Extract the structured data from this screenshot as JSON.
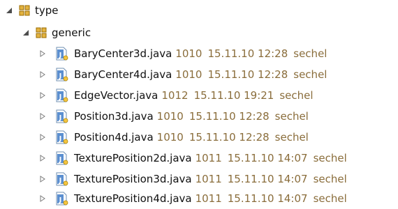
{
  "tree": {
    "root": {
      "label": "type"
    },
    "package": {
      "label": "generic"
    },
    "files": [
      {
        "name": "BaryCenter3d.java",
        "rev": "1010",
        "date": "15.11.10 12:28",
        "author": "sechel"
      },
      {
        "name": "BaryCenter4d.java",
        "rev": "1010",
        "date": "15.11.10 12:28",
        "author": "sechel"
      },
      {
        "name": "EdgeVector.java",
        "rev": "1012",
        "date": "15.11.10 19:21",
        "author": "sechel"
      },
      {
        "name": "Position3d.java",
        "rev": "1010",
        "date": "15.11.10 12:28",
        "author": "sechel"
      },
      {
        "name": "Position4d.java",
        "rev": "1010",
        "date": "15.11.10 12:28",
        "author": "sechel"
      },
      {
        "name": "TexturePosition2d.java",
        "rev": "1011",
        "date": "15.11.10 14:07",
        "author": "sechel"
      },
      {
        "name": "TexturePosition3d.java",
        "rev": "1011",
        "date": "15.11.10 14:07",
        "author": "sechel"
      },
      {
        "name": "TexturePosition4d.java",
        "rev": "1011",
        "date": "15.11.10 14:07",
        "author": "sechel"
      }
    ]
  },
  "colors": {
    "meta_text": "#8a6d3b",
    "package_icon": "#c9a227",
    "java_icon": "#3b7bbf"
  },
  "icons": {
    "expanded_twisty": "triangle-expanded-icon",
    "collapsed_twisty": "triangle-collapsed-icon",
    "package": "package-icon",
    "java_file": "java-file-icon"
  }
}
